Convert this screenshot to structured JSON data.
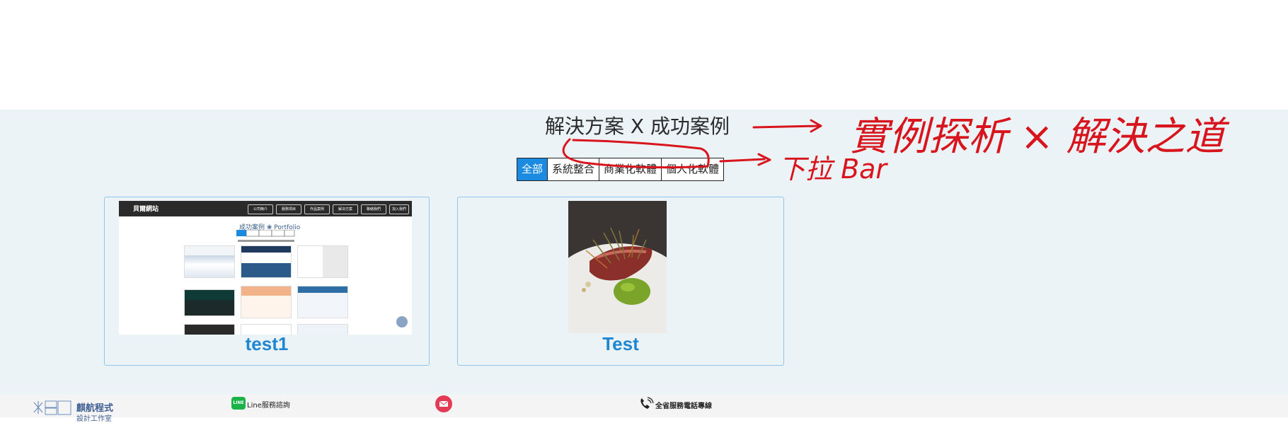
{
  "section": {
    "title": "解決方案 X 成功案例",
    "tabs": [
      {
        "label": "全部",
        "active": true
      },
      {
        "label": "系統整合",
        "active": false
      },
      {
        "label": "商業化軟體",
        "active": false
      },
      {
        "label": "個人化軟體",
        "active": false
      }
    ]
  },
  "cards": [
    {
      "title": "test1",
      "preview": {
        "brand": "貝爾網站",
        "nav": [
          "公司簡介",
          "服務項目",
          "作品案例",
          "解決方案",
          "聯絡我們",
          "加入我們"
        ],
        "heading": "成功案例 ❀ Portfolio"
      }
    },
    {
      "title": "Test"
    }
  ],
  "footer": {
    "brand_name": "麒航程式",
    "brand_sub": "設計工作室",
    "line_label": "Line服務諮詢",
    "phone_label": "全省服務電話專線"
  },
  "annotations": {
    "color": "#d8141c",
    "title_note": "實例探析 × 解決之道",
    "tab_note": "下拉 Bar"
  },
  "colors": {
    "accent": "#1a8be0",
    "card_title": "#1f86d2",
    "section_bg": "#ebf3f7"
  }
}
